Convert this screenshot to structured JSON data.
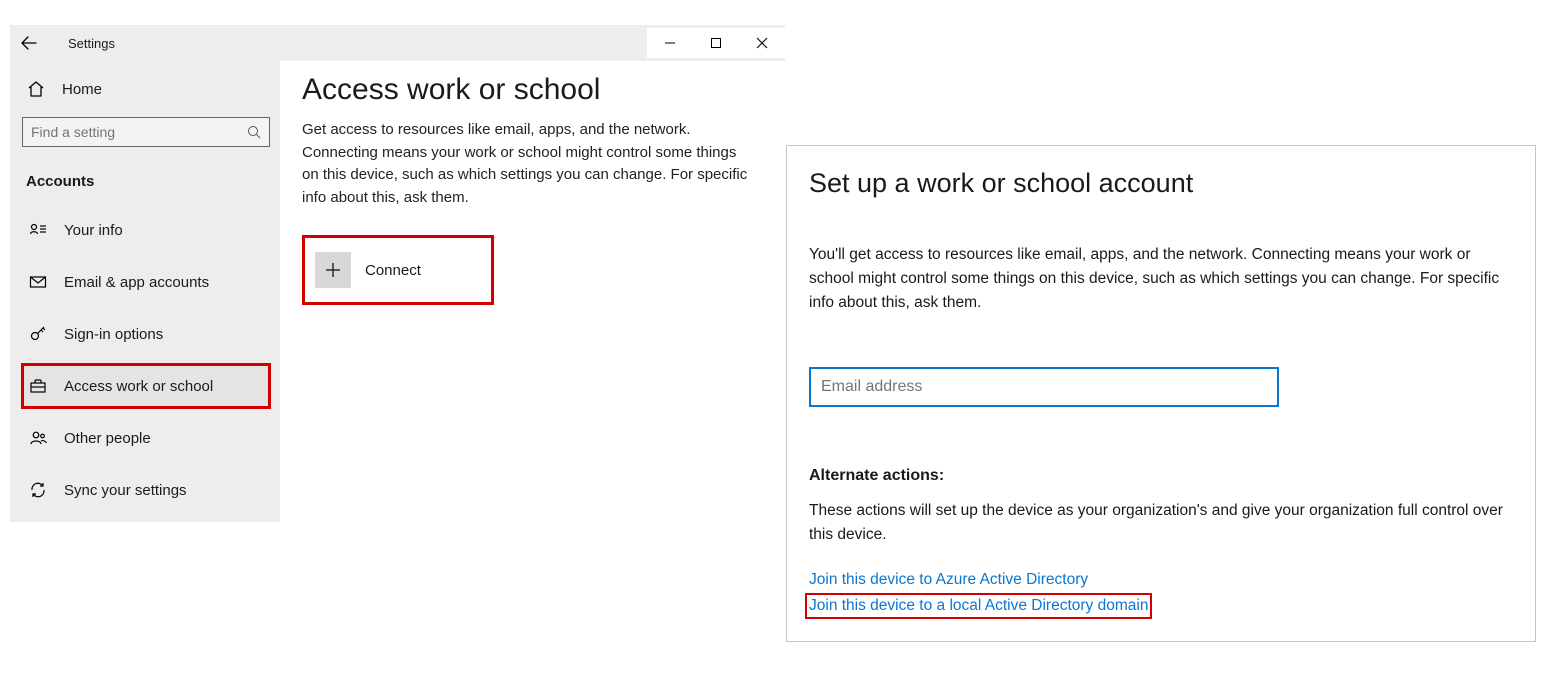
{
  "window": {
    "title": "Settings",
    "home_label": "Home",
    "search_placeholder": "Find a setting",
    "category": "Accounts",
    "nav": [
      {
        "id": "your-info",
        "label": "Your info"
      },
      {
        "id": "email-accounts",
        "label": "Email & app accounts"
      },
      {
        "id": "signin-options",
        "label": "Sign-in options"
      },
      {
        "id": "access-work-school",
        "label": "Access work or school"
      },
      {
        "id": "other-people",
        "label": "Other people"
      },
      {
        "id": "sync-settings",
        "label": "Sync your settings"
      }
    ]
  },
  "content": {
    "heading": "Access work or school",
    "description": "Get access to resources like email, apps, and the network. Connecting means your work or school might control some things on this device, such as which settings you can change. For specific info about this, ask them.",
    "connect_label": "Connect"
  },
  "dialog": {
    "heading": "Set up a work or school account",
    "description": "You'll get access to resources like email, apps, and the network. Connecting means your work or school might control some things on this device, such as which settings you can change. For specific info about this, ask them.",
    "email_placeholder": "Email address",
    "alt_heading": "Alternate actions:",
    "alt_description": "These actions will set up the device as your organization's and give your organization full control over this device.",
    "link_azure": "Join this device to Azure Active Directory",
    "link_local": "Join this device to a local Active Directory domain"
  }
}
